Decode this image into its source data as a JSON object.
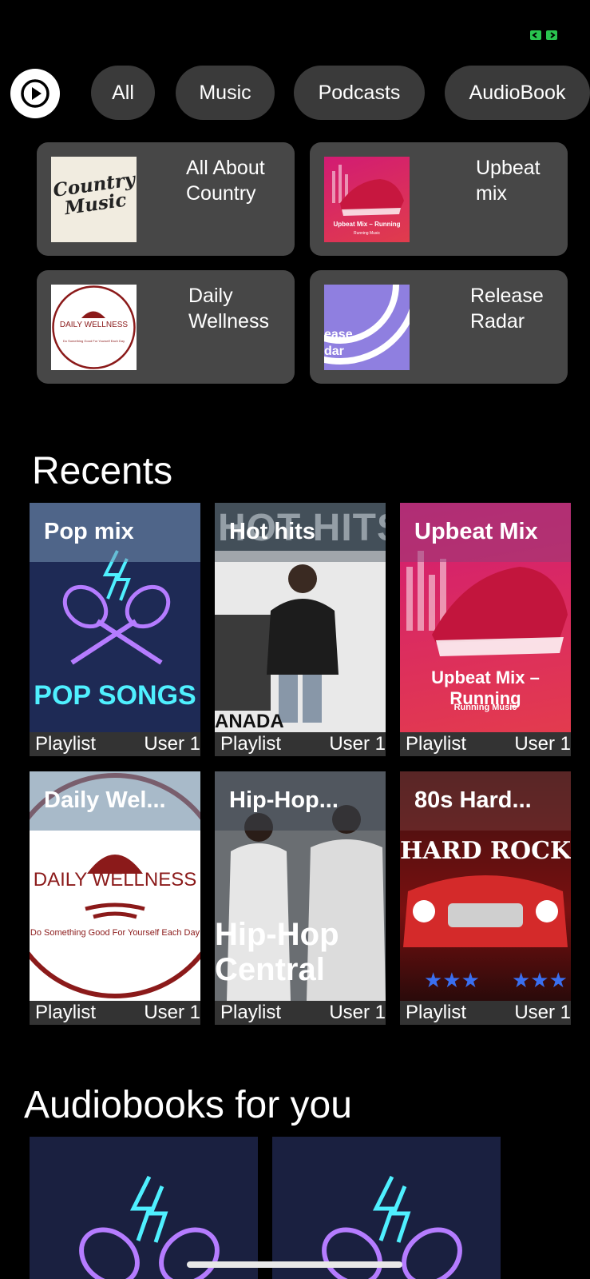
{
  "filters": [
    "All",
    "Music",
    "Podcasts",
    "AudioBook"
  ],
  "shortcuts": [
    {
      "title": "All About Country",
      "art_text": "Country Music"
    },
    {
      "title": "Upbeat mix",
      "art_text": "Upbeat Mix – Running",
      "art_subtext": "Running Music"
    },
    {
      "title": "Daily Wellness",
      "art_text": "DAILY WELLNESS",
      "art_subtext": "Do Something Good For Yourself Each Day"
    },
    {
      "title": "Release Radar",
      "art_text": "ease\ndar"
    }
  ],
  "recents": {
    "title": "Recents",
    "items": [
      {
        "name": "Pop mix",
        "type": "Playlist",
        "owner": "User 1",
        "art_text": "POP SONGS"
      },
      {
        "name": "Hot hits",
        "type": "Playlist",
        "owner": "User 1",
        "art_text": "ANADA",
        "art_top": "HOT HITS"
      },
      {
        "name": "Upbeat Mix",
        "type": "Playlist",
        "owner": "User 1",
        "art_text": "Upbeat Mix – Running",
        "art_subtext": "Running Music"
      },
      {
        "name": "Daily Wel...",
        "type": "Playlist",
        "owner": "User 1",
        "art_text": "DAILY WELLNESS",
        "art_subtext": "Do Something Good For Yourself Each Day"
      },
      {
        "name": "Hip-Hop...",
        "type": "Playlist",
        "owner": "User 1",
        "art_text": "Hip-Hop Central"
      },
      {
        "name": "80s Hard...",
        "type": "Playlist",
        "owner": "User 1",
        "art_text": "HARD ROCK HITS"
      }
    ]
  },
  "audiobooks": {
    "title": "Audiobooks for you"
  },
  "colors": {
    "background": "#000000",
    "chip": "#3a3a3a",
    "card": "#474747",
    "neon_blue": "#4ff0ff",
    "neon_purple": "#b57cff"
  }
}
